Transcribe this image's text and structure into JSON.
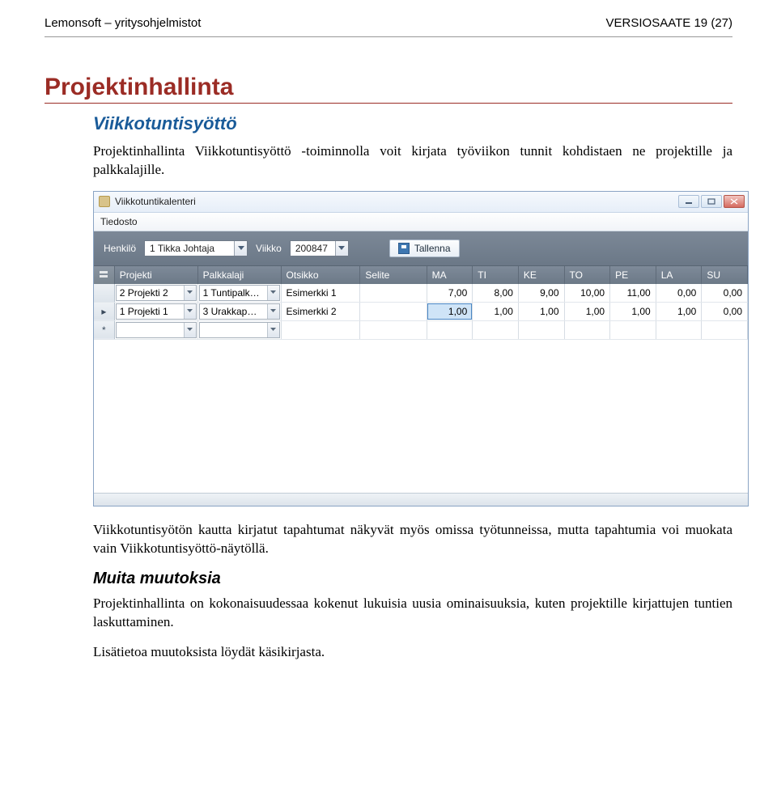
{
  "doc": {
    "header_left": "Lemonsoft – yritysohjelmistot",
    "header_right": "VERSIOSAATE 19 (27)"
  },
  "sections": {
    "h1": "Projektinhallinta",
    "h2": "Viikkotuntisyöttö",
    "intro": "Projektinhallinta Viikkotuntisyöttö -toiminnolla voit kirjata työviikon tunnit kohdistaen ne projektille ja palkkalajille.",
    "mid": "Viikkotuntisyötön kautta kirjatut tapahtumat näkyvät myös omissa työtunneissa, mutta tapahtumia voi muokata vain Viikkotuntisyöttö-näytöllä.",
    "h3": "Muita muutoksia",
    "p2": "Projektinhallinta on kokonaisuudessaa kokenut lukuisia uusia ominaisuuksia, kuten projektille kirjattujen tuntien laskuttaminen.",
    "p3": "Lisätietoa muutoksista löydät käsikirjasta."
  },
  "app": {
    "title": "Viikkotuntikalenteri",
    "menu_file": "Tiedosto",
    "toolbar": {
      "person_label": "Henkilö",
      "person_value": "1 Tikka Johtaja",
      "week_label": "Viikko",
      "week_value": "200847",
      "save_label": "Tallenna"
    },
    "columns": {
      "projekti": "Projekti",
      "palkkalaji": "Palkkalaji",
      "otsikko": "Otsikko",
      "selite": "Selite",
      "ma": "MA",
      "ti": "TI",
      "ke": "KE",
      "to": "TO",
      "pe": "PE",
      "la": "LA",
      "su": "SU"
    },
    "rows": [
      {
        "projekti": "2 Projekti 2",
        "palkkalaji": "1 Tuntipalk…",
        "otsikko": "Esimerkki 1",
        "selite": "",
        "ma": "7,00",
        "ti": "8,00",
        "ke": "9,00",
        "to": "10,00",
        "pe": "11,00",
        "la": "0,00",
        "su": "0,00"
      },
      {
        "projekti": "1 Projekti 1",
        "palkkalaji": "3 Urakkap…",
        "otsikko": "Esimerkki 2",
        "selite": "",
        "ma": "1,00",
        "ti": "1,00",
        "ke": "1,00",
        "to": "1,00",
        "pe": "1,00",
        "la": "1,00",
        "su": "0,00"
      }
    ],
    "row_markers": {
      "pointer": "▸",
      "new": "*"
    }
  }
}
